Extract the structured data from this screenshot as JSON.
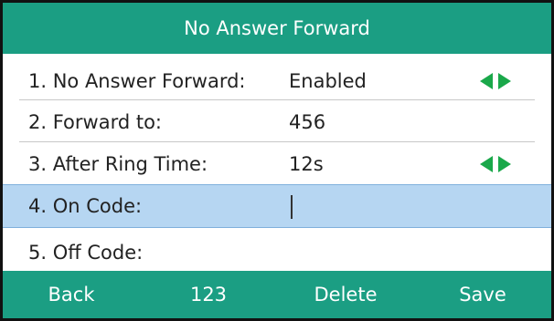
{
  "title": "No Answer Forward",
  "colors": {
    "header": "#1b9e83",
    "selected_row": "#b6d6f2",
    "arrow": "#1aa84a"
  },
  "rows": [
    {
      "label": "1. No Answer Forward:",
      "value": "Enabled",
      "arrows": "left-right-arrow-icon"
    },
    {
      "label": "2. Forward to:",
      "value": "456"
    },
    {
      "label": "3. After Ring Time:",
      "value": "12s",
      "arrows": "left-right-arrow-icon"
    },
    {
      "label": "4. On Code:",
      "value": "",
      "selected": true
    },
    {
      "label": "5. Off Code:",
      "value": ""
    }
  ],
  "softkeys": [
    "Back",
    "123",
    "Delete",
    "Save"
  ]
}
